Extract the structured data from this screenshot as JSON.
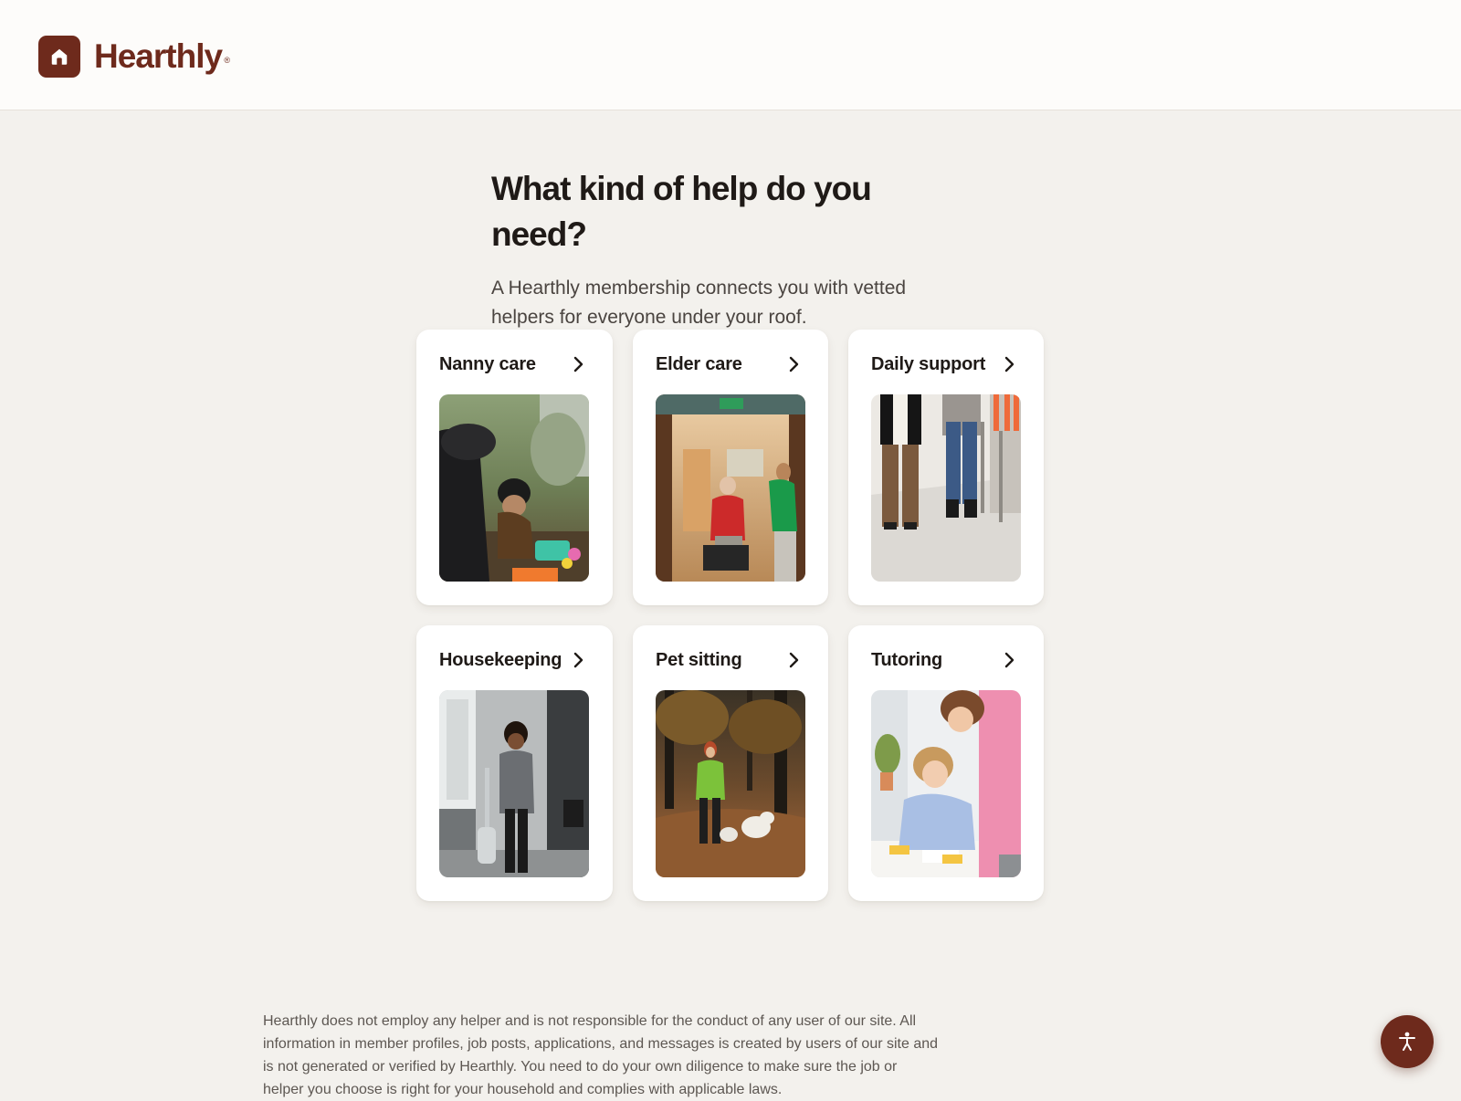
{
  "brand": {
    "name": "Hearthly",
    "registered_mark": "®",
    "logo_icon": "house-icon",
    "color": "#6e2a1c"
  },
  "main": {
    "heading": "What kind of help do you need?",
    "subheading": "A Hearthly membership connects you with vetted helpers for everyone under your roof."
  },
  "categories": [
    {
      "label": "Nanny care",
      "icon": "chevron-right-icon",
      "image": "photo of adult and child playing outdoors with toys"
    },
    {
      "label": "Elder care",
      "icon": "chevron-right-icon",
      "image": "photo of senior with walker and caregiver in hallway"
    },
    {
      "label": "Daily support",
      "icon": "chevron-right-icon",
      "image": "photo of two people walking side by side"
    },
    {
      "label": "Housekeeping",
      "icon": "chevron-right-icon",
      "image": "photo of person vacuuming living room"
    },
    {
      "label": "Pet sitting",
      "icon": "chevron-right-icon",
      "image": "photo of person walking two dogs in park"
    },
    {
      "label": "Tutoring",
      "icon": "chevron-right-icon",
      "image": "photo of tutor helping child write"
    }
  ],
  "footer": {
    "disclaimer": "Hearthly does not employ any helper and is not responsible for the conduct of any user of our site. All information in member profiles, job posts, applications, and messages is created by users of our site and is not generated or verified by Hearthly. You need to do your own diligence to make sure the job or helper you choose is right for your household and complies with applicable laws."
  },
  "accessibility": {
    "icon": "accessibility-icon",
    "color": "#6e2a1c"
  }
}
